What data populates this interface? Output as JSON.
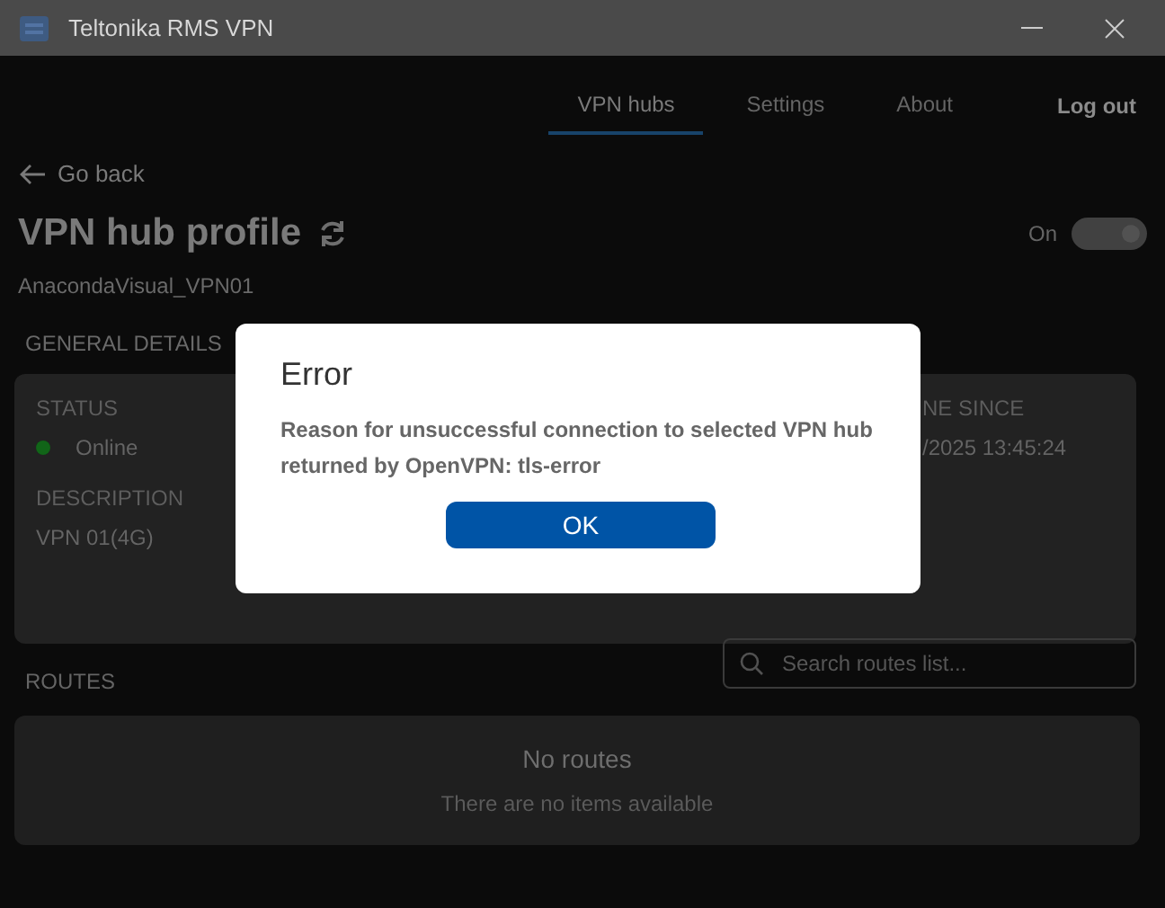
{
  "window": {
    "title": "Teltonika RMS VPN"
  },
  "nav": {
    "tabs": [
      {
        "label": "VPN hubs",
        "selected": true
      },
      {
        "label": "Settings",
        "selected": false
      },
      {
        "label": "About",
        "selected": false
      }
    ],
    "logout": "Log out"
  },
  "back": "Go back",
  "profile": {
    "title": "VPN hub profile",
    "name": "AnacondaVisual_VPN01",
    "toggle": {
      "label": "On",
      "on": true
    }
  },
  "general": {
    "heading": "GENERAL DETAILS",
    "fields": [
      {
        "label": "STATUS",
        "value": "Online",
        "kind": "status"
      },
      {
        "label": "DESCRIPTION",
        "value": "VPN 01(4G)",
        "kind": "text"
      },
      {
        "label": "NE SINCE",
        "value": "/2025 13:45:24",
        "kind": "text"
      }
    ]
  },
  "routes": {
    "heading": "ROUTES",
    "search": {
      "placeholder": "Search routes list..."
    },
    "empty_title": "No routes",
    "empty_text": "There are no items available"
  },
  "dialog": {
    "title": "Error",
    "message": "Reason for unsuccessful connection to selected VPN hub returned by OpenVPN: tls-error",
    "button": "OK"
  }
}
